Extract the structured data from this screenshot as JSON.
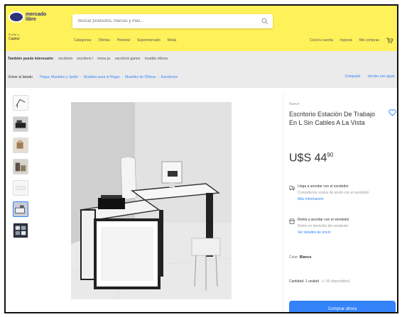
{
  "header": {
    "logo_text": "mercado libre",
    "location_label": "Enviar a",
    "location_value": "Capital",
    "search_placeholder": "Buscar productos, marcas y más...",
    "nav": [
      "Categorías",
      "Ofertas",
      "Historial",
      "Supermercado",
      "Moda"
    ],
    "user_nav": [
      "Creá tu cuenta",
      "Ingresá",
      "Mis compras"
    ]
  },
  "related": {
    "label": "También puede interesarte:",
    "links": [
      "escritorio",
      "escritorio l",
      "mesa pc",
      "escritorio gamer",
      "mueble oficina"
    ]
  },
  "breadcrumb": {
    "back": "Volver al listado",
    "items": [
      "Hogar, Muebles y Jardín",
      "Muebles para el Hogar",
      "Muebles de Oficina",
      "Escritorios"
    ],
    "actions": [
      "Compartir",
      "Vender uno igual"
    ]
  },
  "product": {
    "condition": "Nuevo",
    "title": "Escritorio Estación De Trabajo En L Sin Cables A La Vista",
    "price_main": "U$S 44",
    "price_cents": "90",
    "perks": [
      {
        "title": "Llega a acordar con el vendedor",
        "sub": "Consultá los costos de envío con el vendedor",
        "link": "Más información"
      },
      {
        "title": "Retirá a acordar con el vendedor",
        "sub": "Retiro en domicilio del vendedor",
        "link": "Ver detalles de envío"
      }
    ],
    "color_label": "Color:",
    "color_value": "Blanco",
    "quantity_label": "Cantidad: 1 unidad",
    "quantity_available": "(+ 50 disponibles)",
    "buy_label": "Comprar ahora"
  },
  "colors": {
    "header_yellow": "#fff159",
    "brand_blue": "#2d3277",
    "link_blue": "#3483fa",
    "panel_bg": "#ffffff",
    "page_bg": "#ebebeb"
  },
  "icons": {
    "search": "search-icon",
    "cart": "cart-icon",
    "favorite": "heart-icon",
    "truck": "truck-icon",
    "store": "store-icon"
  },
  "thumbnails_count": 7,
  "selected_thumbnail": 6
}
